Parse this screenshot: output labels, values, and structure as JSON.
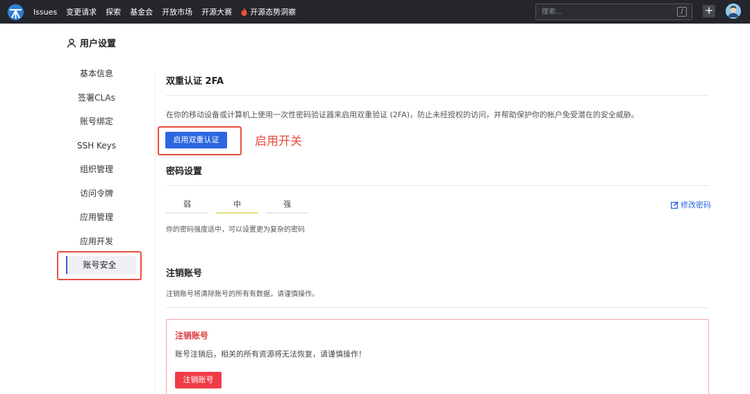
{
  "nav": {
    "items": [
      "Issues",
      "变更请求",
      "探索",
      "基金会",
      "开放市场",
      "开源大赛",
      "开源态势洞察"
    ],
    "search_placeholder": "搜索...",
    "search_shortcut": "/",
    "plus_label": "+"
  },
  "settings": {
    "title": "用户设置"
  },
  "sidebar": {
    "items": [
      "基本信息",
      "签署CLAs",
      "账号绑定",
      "SSH Keys",
      "组织管理",
      "访问令牌",
      "应用管理",
      "应用开发",
      "账号安全"
    ],
    "active": "账号安全"
  },
  "twofa": {
    "title": "双重认证 2FA",
    "description": "在你的移动设备或计算机上使用一次性密码验证器来启用双重验证 (2FA)，防止未经授权的访问，并帮助保护你的帐户免受潜在的安全威胁。",
    "button_label": "启用双重认证",
    "annotation": "启用开关"
  },
  "password": {
    "title": "密码设置",
    "levels": [
      "弱",
      "中",
      "强"
    ],
    "current_level": "中",
    "change_label": "修改密码",
    "strength_hint": "你的密码强度适中，可以设置更为复杂的密码"
  },
  "delete_account": {
    "title": "注销账号",
    "description": "注销账号将清除账号的所有有数据，请谨慎操作。",
    "box_title": "注销账号",
    "box_description": "账号注销后，相关的所有资源将无法恢复，请谨慎操作！",
    "button_label": "注销账号"
  },
  "colors": {
    "topbar_bg": "#24262b",
    "primary": "#2c67e1",
    "danger": "#f23c48",
    "annotation_red": "#e84d3d",
    "medium_strength": "#e6e07a"
  }
}
